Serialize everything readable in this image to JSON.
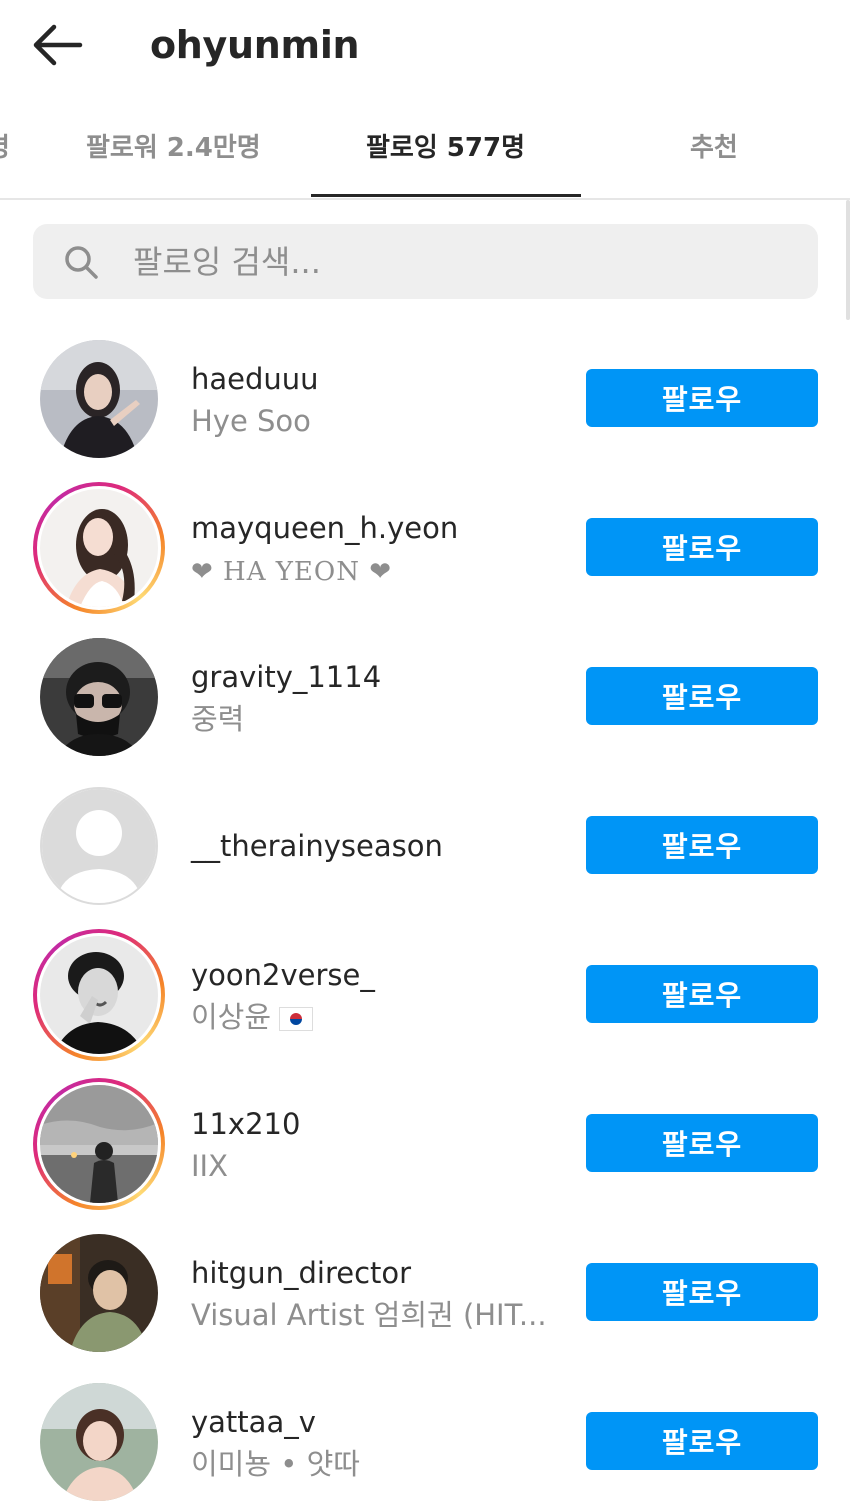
{
  "header": {
    "username": "ohyunmin"
  },
  "tabs": [
    {
      "label": "명",
      "active": false
    },
    {
      "label": "팔로워 2.4만명",
      "active": false
    },
    {
      "label": "팔로잉 577명",
      "active": true
    },
    {
      "label": "추천",
      "active": false
    }
  ],
  "search": {
    "placeholder": "팔로잉 검색..."
  },
  "colors": {
    "follow_button": "#0095f6",
    "secondary_text": "#8e8e8e",
    "story_ring": "#dd2a7b"
  },
  "following": [
    {
      "username": "haeduuu",
      "subtitle": "Hye Soo",
      "button": "팔로우",
      "story_ring": false
    },
    {
      "username": "mayqueen_h.yeon",
      "subtitle": "❤ HA YEON ❤",
      "button": "팔로우",
      "story_ring": true
    },
    {
      "username": "gravity_1114",
      "subtitle": "중력",
      "button": "팔로우",
      "story_ring": false
    },
    {
      "username": "__therainyseason",
      "subtitle": "",
      "button": "팔로우",
      "story_ring": false
    },
    {
      "username": "yoon2verse_",
      "subtitle": "이상윤",
      "button": "팔로우",
      "story_ring": true,
      "flag_icon": "korea-flag-icon"
    },
    {
      "username": "11x210",
      "subtitle": "IIX",
      "button": "팔로우",
      "story_ring": true
    },
    {
      "username": "hitgun_director",
      "subtitle": "Visual Artist 엄희권 (HIT...",
      "button": "팔로우",
      "story_ring": false
    },
    {
      "username": "yattaa_v",
      "subtitle": "이미뇽 • 얏따",
      "button": "팔로우",
      "story_ring": false
    }
  ]
}
